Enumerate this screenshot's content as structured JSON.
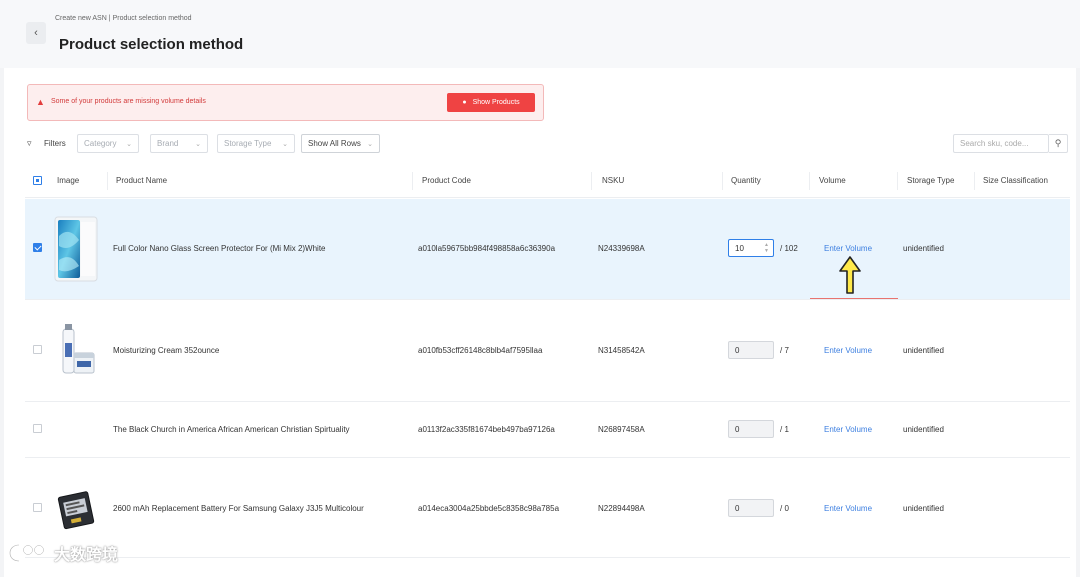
{
  "header": {
    "breadcrumb_parent": "Create new ASN",
    "breadcrumb_current": "Product selection method",
    "title": "Product selection method"
  },
  "alert": {
    "message": "Some of your products are missing volume details",
    "button_label": "Show Products"
  },
  "filters": {
    "label": "Filters",
    "category": "Category",
    "brand": "Brand",
    "storage_type": "Storage Type",
    "rows": "Show All Rows",
    "search_placeholder": "Search sku, code..."
  },
  "table": {
    "headers": {
      "image": "Image",
      "product_name": "Product Name",
      "product_code": "Product Code",
      "nsku": "NSKU",
      "quantity": "Quantity",
      "volume": "Volume",
      "storage_type": "Storage Type",
      "size_classification": "Size Classification"
    },
    "rows": [
      {
        "name": "Full Color Nano Glass Screen Protector For (Mi Mix 2)White",
        "code": "a010la59675bb984f498858a6c36390a",
        "nsku": "N24339698A",
        "qty": "10",
        "total": "/ 102",
        "volume": "Enter Volume",
        "storage": "unidentified",
        "checked": true
      },
      {
        "name": "Moisturizing Cream 352ounce",
        "code": "a010fb53cff26148c8blb4af7595llaa",
        "nsku": "N31458542A",
        "qty": "0",
        "total": "/ 7",
        "volume": "Enter Volume",
        "storage": "unidentified",
        "checked": false
      },
      {
        "name": "The Black Church in America African American Christian Spirtuality",
        "code": "a0113f2ac335f81674beb497ba97126a",
        "nsku": "N26897458A",
        "qty": "0",
        "total": "/ 1",
        "volume": "Enter Volume",
        "storage": "unidentified",
        "checked": false
      },
      {
        "name": "2600 mAh Replacement Battery For Samsung Galaxy J3J5 Multicolour",
        "code": "a014eca3004a25bbde5c8358c98a785a",
        "nsku": "N22894498A",
        "qty": "0",
        "total": "/ 0",
        "volume": "Enter Volume",
        "storage": "unidentified",
        "checked": false
      }
    ]
  },
  "watermark": {
    "text": "大数跨境"
  },
  "colors": {
    "accent": "#2f7fe8",
    "alert_red": "#ef4343",
    "selected_row": "#e9f4fd",
    "link": "#3d7fe0"
  },
  "icons": [
    "back-arrow-icon",
    "warning-icon",
    "filter-icon",
    "chevron-down-icon",
    "search-icon",
    "up-arrow-annotation-icon",
    "watermark-logo-icon"
  ]
}
